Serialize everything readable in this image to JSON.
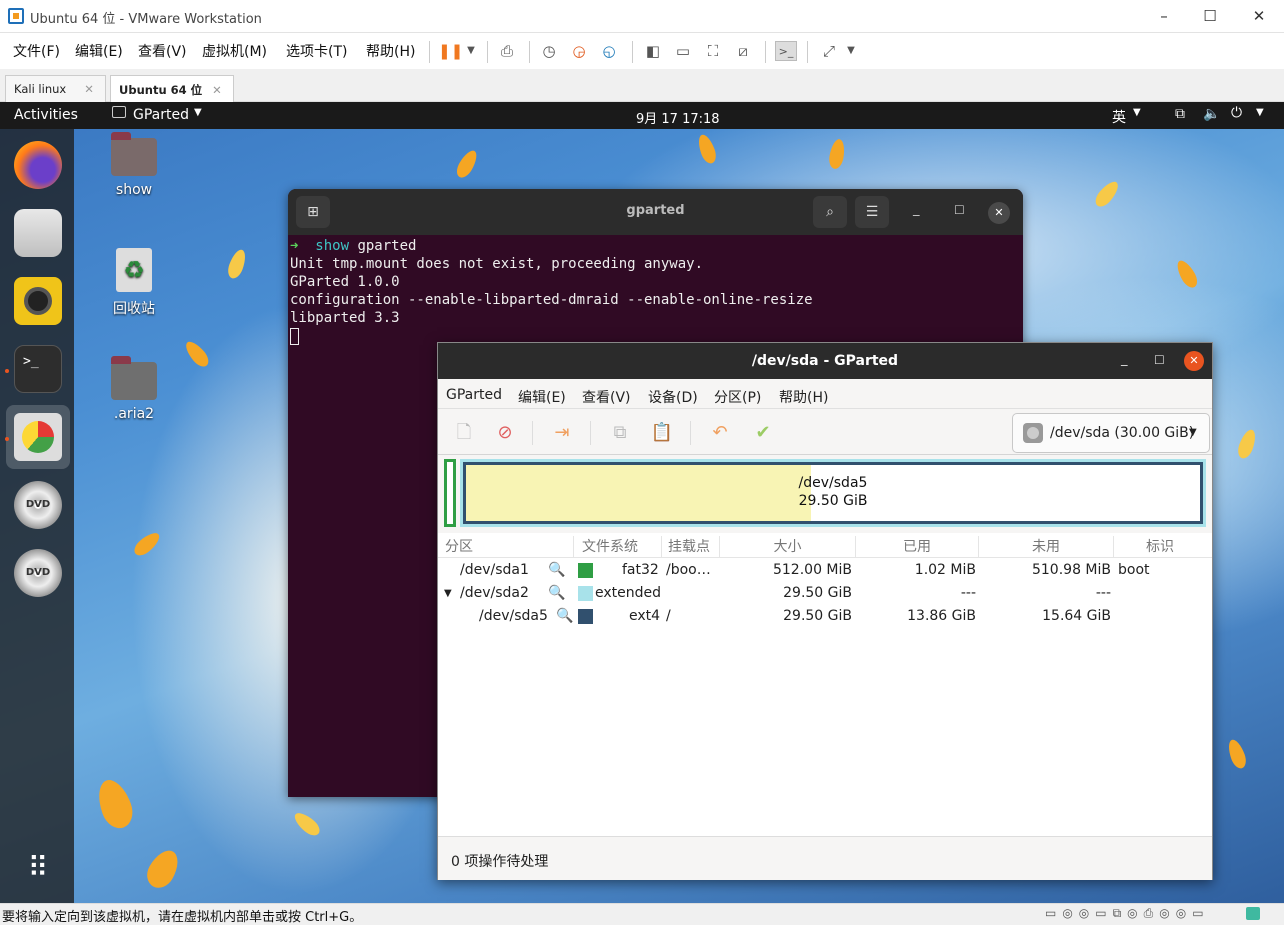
{
  "vmware": {
    "title": "Ubuntu 64 位 - VMware Workstation",
    "menu": [
      "文件(F)",
      "编辑(E)",
      "查看(V)",
      "虚拟机(M)",
      "选项卡(T)",
      "帮助(H)"
    ],
    "tabs": [
      {
        "label": "Kali linux"
      },
      {
        "label": "Ubuntu 64 位"
      }
    ],
    "status": "要将输入定向到该虚拟机，请在虚拟机内部单击或按 Ctrl+G。"
  },
  "ubuntu": {
    "activities": "Activities",
    "app_menu": "GParted",
    "clock": "9月 17  17:18",
    "input_method": "英",
    "desktop_icons": [
      {
        "label": "show"
      },
      {
        "label": "回收站"
      },
      {
        "label": ".aria2"
      }
    ]
  },
  "terminal": {
    "title": "gparted",
    "prompt_dir": "show",
    "command": "gparted",
    "lines": [
      "Unit tmp.mount does not exist, proceeding anyway.",
      "GParted 1.0.0",
      "configuration --enable-libparted-dmraid --enable-online-resize",
      "libparted 3.3"
    ]
  },
  "gparted": {
    "title": "/dev/sda - GParted",
    "menu": [
      "GParted",
      "编辑(E)",
      "查看(V)",
      "设备(D)",
      "分区(P)",
      "帮助(H)"
    ],
    "device": "/dev/sda (30.00 GiB)",
    "graph": {
      "name": "/dev/sda5",
      "size": "29.50 GiB",
      "used_fraction": 0.47
    },
    "columns": [
      "分区",
      "文件系统",
      "挂载点",
      "大小",
      "已用",
      "未用",
      "标识"
    ],
    "rows": [
      {
        "partition": "/dev/sda1",
        "fs": "fat32",
        "fs_color": "#2f9e44",
        "mount": "/boo…",
        "size": "512.00 MiB",
        "used": "1.02 MiB",
        "unused": "510.98 MiB",
        "flags": "boot"
      },
      {
        "partition": "/dev/sda2",
        "fs": "extended",
        "fs_color": "#a8e2ea",
        "mount": "",
        "size": "29.50 GiB",
        "used": "---",
        "unused": "---",
        "flags": ""
      },
      {
        "partition": "/dev/sda5",
        "fs": "ext4",
        "fs_color": "#31506e",
        "mount": "/",
        "size": "29.50 GiB",
        "used": "13.86 GiB",
        "unused": "15.64 GiB",
        "flags": ""
      }
    ],
    "status": "0 项操作待处理"
  }
}
